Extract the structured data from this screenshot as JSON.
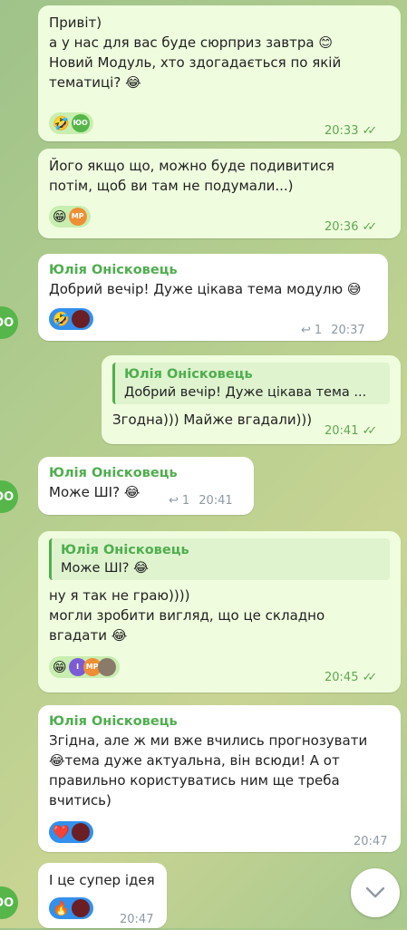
{
  "colors": {
    "accent": "#4fae4e",
    "outgoing_bubble": "#effdde",
    "incoming_bubble": "#ffffff",
    "reaction_blue": "#3390ec"
  },
  "messages": [
    {
      "lines": [
        "Привіт)",
        "а у нас для вас буде сюрприз завтра 😊",
        "Новий Модуль, хто здогадається по якій",
        "тематиці? 😂"
      ],
      "reaction_emoji": "🤣",
      "reaction_user": "ЮО",
      "time": "20:33"
    },
    {
      "lines": [
        "Його якщо що, можно буде подивитися",
        "потім, щоб ви там не подумали...)"
      ],
      "reaction_emoji": "😁",
      "reaction_user": "МР",
      "time": "20:36"
    },
    {
      "sender": "Юлія Онісковець",
      "lines": [
        "Добрий вечір! Дуже цікава тема модулю 😅"
      ],
      "reaction_emoji": "🤣",
      "replies": "1",
      "time": "20:37",
      "avatar": "ЮО"
    },
    {
      "quote_sender": "Юлія Онісковець",
      "quote_text": "Добрий вечір! Дуже цікава тема ...",
      "lines": [
        "Згодна))) Майже вгадали)))"
      ],
      "time": "20:41"
    },
    {
      "sender": "Юлія Онісковець",
      "lines": [
        "Може ШІ? 😂"
      ],
      "replies": "1",
      "time": "20:41",
      "avatar": "ЮО"
    },
    {
      "quote_sender": "Юлія Онісковець",
      "quote_text": "Може ШІ? 😂",
      "lines": [
        "ну я так не граю))))",
        "могли зробити вигляд, що це складно",
        "вгадати 😂"
      ],
      "reaction_emoji": "😁",
      "reaction_users": [
        "І",
        "МР"
      ],
      "time": "20:45"
    },
    {
      "sender": "Юлія Онісковець",
      "lines": [
        "Згідна, але ж ми вже вчились прогнозувати",
        "😂тема дуже актуальна, він всюди! А от",
        "правильно користуватись ним ще треба",
        "вчитись)"
      ],
      "reaction_emoji": "❤️",
      "time": "20:47"
    },
    {
      "lines": [
        "І це супер ідея"
      ],
      "reaction_emoji": "🔥",
      "time": "20:47",
      "avatar": "ЮО"
    }
  ],
  "icons": {
    "scroll_down": "chevron-down-icon",
    "reply": "reply-arrow-icon",
    "read": "double-check-icon"
  }
}
